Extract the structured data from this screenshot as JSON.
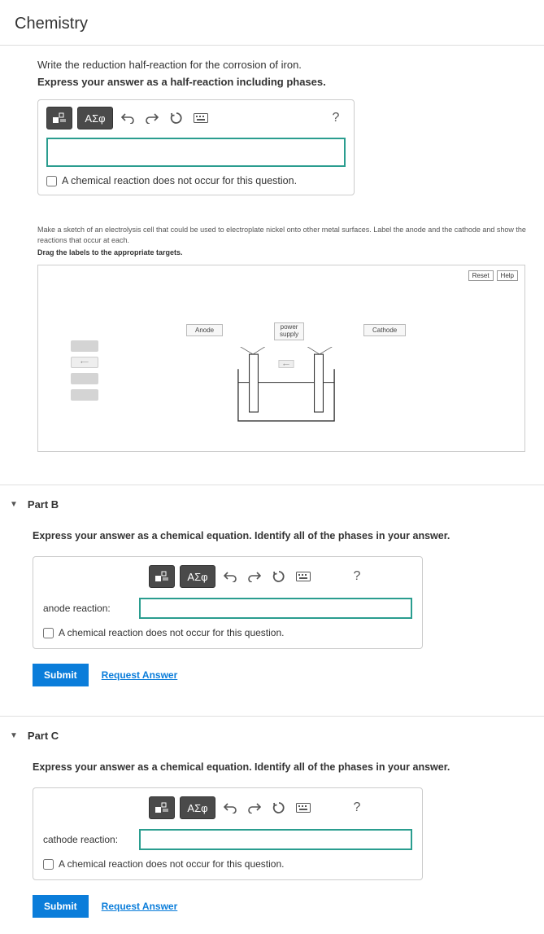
{
  "page": {
    "title": "Chemistry"
  },
  "q1": {
    "prompt": "Write the reduction half-reaction for the corrosion of iron.",
    "instruction": "Express your answer as a half-reaction including phases.",
    "symbols_btn": "ΑΣφ",
    "help_btn": "?",
    "no_reaction": "A chemical reaction does not occur for this question."
  },
  "sketch": {
    "prompt": "Make a sketch of an electrolysis cell that could be used to electroplate nickel onto other metal surfaces. Label the anode and the cathode and show the reactions that occur at each.",
    "instruction": "Drag the labels to the appropriate targets.",
    "reset": "Reset",
    "help": "Help",
    "anode": "Anode",
    "cathode": "Cathode",
    "power_supply_l1": "power",
    "power_supply_l2": "supply"
  },
  "partB": {
    "header": "Part B",
    "instruction": "Express your answer as a chemical equation. Identify all of the phases in your answer.",
    "symbols_btn": "ΑΣφ",
    "help_btn": "?",
    "field_label": "anode reaction:",
    "no_reaction": "A chemical reaction does not occur for this question.",
    "submit": "Submit",
    "request": "Request Answer"
  },
  "partC": {
    "header": "Part C",
    "instruction": "Express your answer as a chemical equation. Identify all of the phases in your answer.",
    "symbols_btn": "ΑΣφ",
    "help_btn": "?",
    "field_label": "cathode reaction:",
    "no_reaction": "A chemical reaction does not occur for this question.",
    "submit": "Submit",
    "request": "Request Answer"
  }
}
